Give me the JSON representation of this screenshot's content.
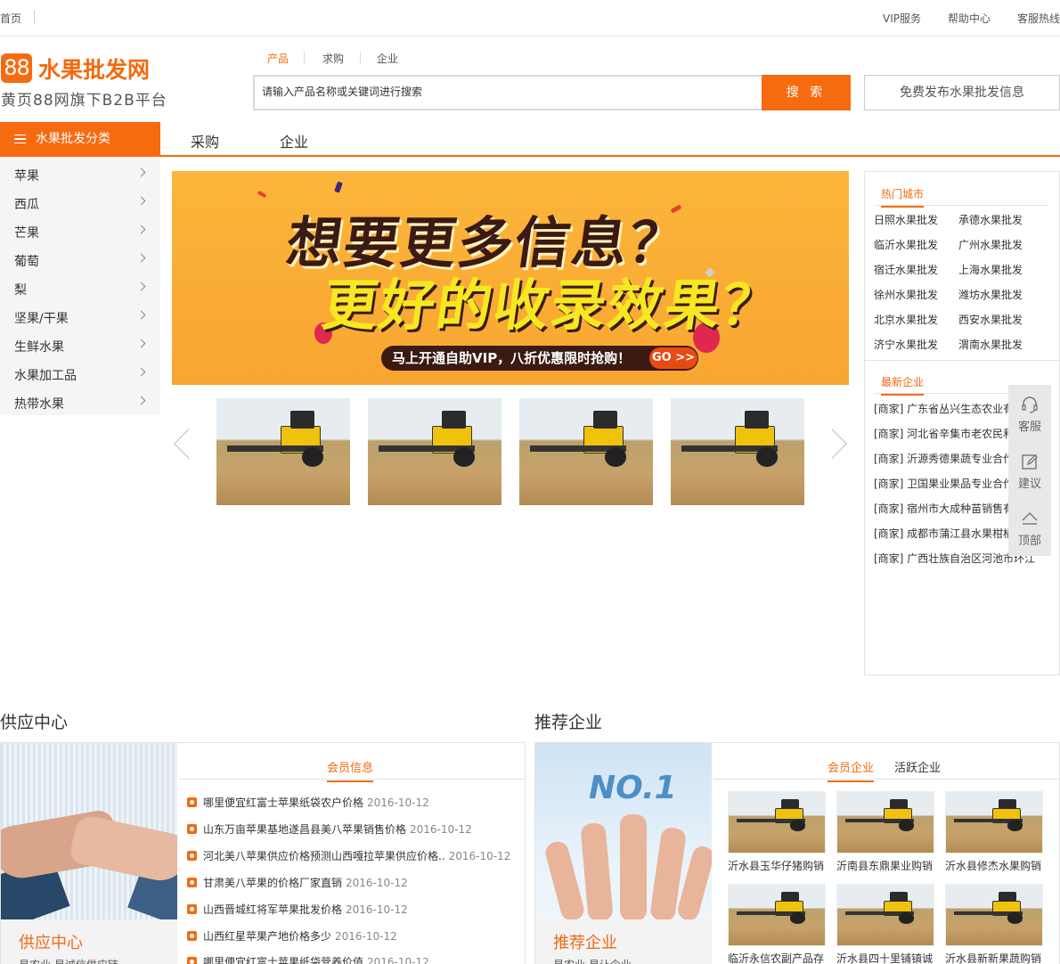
{
  "topbar": {
    "home": "首页",
    "links": [
      "VIP服务",
      "帮助中心",
      "客服热线"
    ]
  },
  "logo": {
    "mark": "88",
    "title": "水果批发网",
    "subtitle": "黄页88网旗下B2B平台"
  },
  "search": {
    "tabs": [
      "产品",
      "求购",
      "企业"
    ],
    "active_tab": "产品",
    "placeholder": "请输入产品名称或关键词进行搜索",
    "button": "搜 索",
    "publish": "免费发布水果批发信息"
  },
  "nav": {
    "category_head": "水果批发分类",
    "links": [
      "采购",
      "企业"
    ]
  },
  "categories": [
    "苹果",
    "西瓜",
    "芒果",
    "葡萄",
    "梨",
    "坚果/干果",
    "生鲜水果",
    "水果加工品",
    "热带水果"
  ],
  "banner": {
    "line1": "想要更多信息？",
    "line2": "更好的收录效果？",
    "promo": "马上开通自助VIP，八折优惠限时抢购！",
    "go": "GO >>"
  },
  "hot_cities": {
    "title": "热门城市",
    "items": [
      "日照水果批发",
      "承德水果批发",
      "临沂水果批发",
      "广州水果批发",
      "宿迁水果批发",
      "上海水果批发",
      "徐州水果批发",
      "潍坊水果批发",
      "北京水果批发",
      "西安水果批发",
      "济宁水果批发",
      "渭南水果批发"
    ]
  },
  "latest_companies": {
    "title": "最新企业",
    "items": [
      "[商家] 广东省丛兴生态农业有",
      "[商家] 河北省辛集市老农民和",
      "[商家] 沂源秀德果蔬专业合作",
      "[商家] 卫国果业果品专业合作",
      "[商家] 宿州市大成种苗销售有",
      "[商家] 成都市蒲江县水果柑橘",
      "[商家] 广西壮族自治区河池市环江"
    ]
  },
  "side_tools": [
    "客服",
    "建议",
    "顶部"
  ],
  "supply": {
    "title": "供应中心",
    "image_caption": "供应中心",
    "image_sub": "易农业 易诚信供应链",
    "tab": "会员信息",
    "items": [
      {
        "text": "哪里便宜红富士苹果纸袋农户价格",
        "date": "2016-10-12"
      },
      {
        "text": "山东万亩苹果基地遂昌县美八苹果销售价格",
        "date": "2016-10-12"
      },
      {
        "text": "河北美八苹果供应价格预测山西嘎拉苹果供应价格..",
        "date": "2016-10-12"
      },
      {
        "text": "甘肃美八苹果的价格厂家直销",
        "date": "2016-10-12"
      },
      {
        "text": "山西晋城红将军苹果批发价格",
        "date": "2016-10-12"
      },
      {
        "text": "山西红星苹果产地价格多少",
        "date": "2016-10-12"
      },
      {
        "text": "哪里便宜红富士苹果纸袋营养价值",
        "date": "2016-10-12"
      }
    ]
  },
  "recommend": {
    "title": "推荐企业",
    "image_caption": "推荐企业",
    "image_sub": "易农业 易让企业",
    "image_badge": "NO.1",
    "tabs": [
      "会员企业",
      "活跃企业"
    ],
    "companies": [
      "沂水县玉华仔猪购销",
      "沂南县东鼎果业购销",
      "沂水县修杰水果购销",
      "临沂永信农副产品存",
      "沂水县四十里铺镇诚",
      "沂水县新新果蔬购销"
    ]
  },
  "colors": {
    "accent": "#f66a10",
    "text": "#333333",
    "panel_bg": "#f5f5f5"
  }
}
